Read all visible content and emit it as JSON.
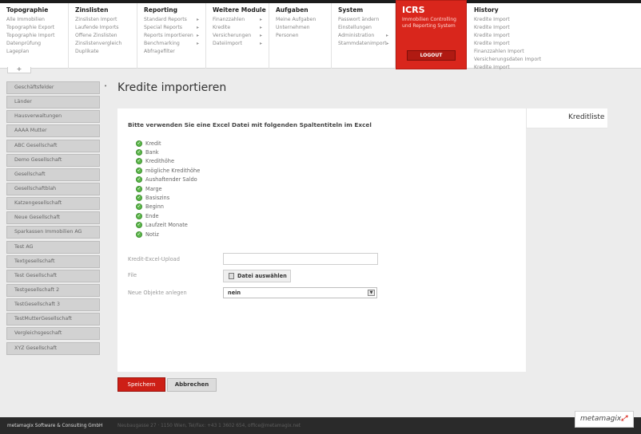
{
  "nav": {
    "columns": [
      {
        "title": "Topographie",
        "items": [
          {
            "label": "Alle Immobilien",
            "arrow": false
          },
          {
            "label": "Topographie Export",
            "arrow": false
          },
          {
            "label": "Topographie Import",
            "arrow": false
          },
          {
            "label": "Datenprüfung",
            "arrow": false
          },
          {
            "label": "Lageplan",
            "arrow": false
          }
        ]
      },
      {
        "title": "Zinslisten",
        "items": [
          {
            "label": "Zinslisten Import",
            "arrow": false
          },
          {
            "label": "Laufende Imports",
            "arrow": false
          },
          {
            "label": "Offene Zinslisten",
            "arrow": false
          },
          {
            "label": "Zinslistenvergleich",
            "arrow": false
          },
          {
            "label": "Duplikate",
            "arrow": false
          }
        ]
      },
      {
        "title": "Reporting",
        "items": [
          {
            "label": "Standard Reports",
            "arrow": true
          },
          {
            "label": "Special Reports",
            "arrow": true
          },
          {
            "label": "Reports importieren",
            "arrow": true
          },
          {
            "label": "Benchmarking",
            "arrow": true
          },
          {
            "label": "Abfragefilter",
            "arrow": false
          }
        ]
      },
      {
        "title": "Weitere Module",
        "items": [
          {
            "label": "Finanzzahlen",
            "arrow": true
          },
          {
            "label": "Kredite",
            "arrow": true
          },
          {
            "label": "Versicherungen",
            "arrow": true
          },
          {
            "label": "Dateiimport",
            "arrow": true
          }
        ]
      },
      {
        "title": "Aufgaben",
        "items": [
          {
            "label": "Meine Aufgaben",
            "arrow": false
          },
          {
            "label": "Unternehmen",
            "arrow": false
          },
          {
            "label": "Personen",
            "arrow": false
          }
        ]
      },
      {
        "title": "System",
        "items": [
          {
            "label": "Passwort ändern",
            "arrow": false
          },
          {
            "label": "Einstellungen",
            "arrow": false
          },
          {
            "label": "Administration",
            "arrow": true
          },
          {
            "label": "Stammdatenimport",
            "arrow": true
          }
        ]
      }
    ],
    "icrs": {
      "title": "ICRS",
      "subtitle": "Immobilien Controlling und Reporting System",
      "logout_label": "LOGOUT"
    },
    "history": {
      "title": "History",
      "items": [
        {
          "label": "Kredite Import"
        },
        {
          "label": "Kredite Import"
        },
        {
          "label": "Kredite Import"
        },
        {
          "label": "Kredite Import"
        },
        {
          "label": "Finanzzahlen Import"
        },
        {
          "label": "Versicherungsdaten Import"
        },
        {
          "label": "Kredite Import"
        }
      ]
    },
    "tree_toggle": "+"
  },
  "sidebar": {
    "items": [
      {
        "label": "Geschäftsfelder"
      },
      {
        "label": "Länder"
      },
      {
        "label": "Hausverwaltungen"
      },
      {
        "label": "AAAA Mutter"
      },
      {
        "label": "ABC Gesellschaft"
      },
      {
        "label": "Demo Gesellschaft"
      },
      {
        "label": "Gesellschaft"
      },
      {
        "label": "Gesellschaftblah"
      },
      {
        "label": "Katzengesellschaft"
      },
      {
        "label": "Neue Gesellschaft"
      },
      {
        "label": "Sparkassen Immobilien AG"
      },
      {
        "label": "Test AG"
      },
      {
        "label": "Textgesellschaft"
      },
      {
        "label": "Test Gesellschaft"
      },
      {
        "label": "Testgesellschaft 2"
      },
      {
        "label": "TestGesellschaft 3"
      },
      {
        "label": "TestMutterGesellschaft"
      },
      {
        "label": "Vergleichsgeschaft"
      },
      {
        "label": "XYZ Gesellschaft"
      }
    ],
    "marker": "•"
  },
  "main": {
    "title": "Kredite importieren",
    "tab_label": "Kreditliste",
    "intro": "Bitte verwenden Sie eine Excel Datei mit folgenden Spaltentiteln im Excel",
    "columns": [
      {
        "label": "Kredit"
      },
      {
        "label": "Bank"
      },
      {
        "label": "Kredithöhe"
      },
      {
        "label": "mögliche Kredithöhe"
      },
      {
        "label": "Aushaftender Saldo"
      },
      {
        "label": "Marge"
      },
      {
        "label": "Basiszins"
      },
      {
        "label": "Beginn"
      },
      {
        "label": "Ende"
      },
      {
        "label": "Laufzeit Monate"
      },
      {
        "label": "Notiz"
      }
    ],
    "form": {
      "upload_label": "Kredit-Excel-Upload",
      "upload_value": "",
      "file_label": "File",
      "file_button": "Datei auswählen",
      "objects_label": "Neue Objekte anlegen",
      "objects_value": "nein"
    },
    "save_label": "Speichern",
    "cancel_label": "Abbrechen"
  },
  "footer": {
    "company": "metamagix Software & Consulting GmbH",
    "address": "Neubaugasse 27 · 1150 Wien, Tel/Fax: +43 1 3602 654, office@metamagix.net",
    "logo": "metamagix"
  },
  "colors": {
    "accent": "#d9261c",
    "check": "#5cb84a"
  }
}
